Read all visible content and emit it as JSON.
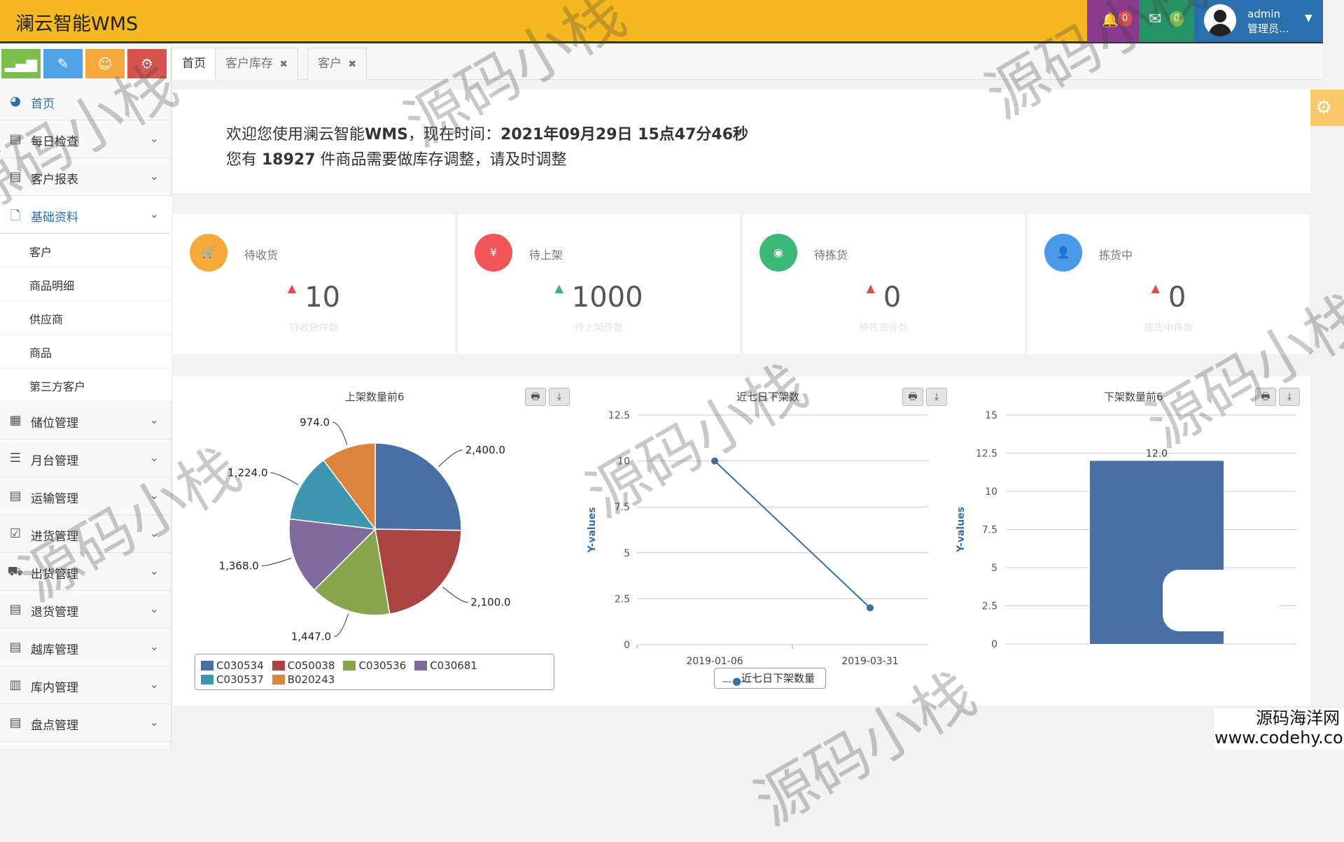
{
  "header": {
    "brand": "澜云智能WMS",
    "bell_count": "0",
    "mail_count": "0",
    "user_name": "admin",
    "user_role": "管理员...",
    "bell_color": "#8b3a8f",
    "mail_color": "#279266",
    "user_color": "#2a6fae",
    "bar_color": "#f5b820"
  },
  "sidebar": {
    "top_buttons": [
      {
        "icon": "signal-icon",
        "color": "#7cbf4f"
      },
      {
        "icon": "pencil-icon",
        "color": "#4fa3e4"
      },
      {
        "icon": "users-icon",
        "color": "#f5a93a"
      },
      {
        "icon": "cogs-icon",
        "color": "#d9534f"
      }
    ],
    "items": [
      {
        "label": "首页",
        "icon": "dashboard-icon"
      },
      {
        "label": "每日检查",
        "icon": "list-icon"
      },
      {
        "label": "客户报表",
        "icon": "list-icon"
      },
      {
        "label": "基础资料",
        "icon": "file-icon"
      },
      {
        "label": "储位管理",
        "icon": "building-icon"
      },
      {
        "label": "月台管理",
        "icon": "list-icon"
      },
      {
        "label": "运输管理",
        "icon": "list-icon"
      },
      {
        "label": "进货管理",
        "icon": "check-icon"
      },
      {
        "label": "出货管理",
        "icon": "truck-icon"
      },
      {
        "label": "退货管理",
        "icon": "list-icon"
      },
      {
        "label": "越库管理",
        "icon": "list-icon"
      },
      {
        "label": "库内管理",
        "icon": "film-icon"
      },
      {
        "label": "盘点管理",
        "icon": "list-icon"
      }
    ],
    "sub_items": [
      "客户",
      "商品明细",
      "供应商",
      "商品",
      "第三方客户"
    ]
  },
  "tabs": [
    {
      "label": "首页",
      "closable": false
    },
    {
      "label": "客户库存",
      "closable": true
    },
    {
      "label": "客户",
      "closable": true
    }
  ],
  "welcome": {
    "line1_prefix": "欢迎您使用澜云智能",
    "line1_app": "WMS",
    "line1_mid": "，现在时间：",
    "line1_time": "2021年09月29日 15点47分46秒",
    "line2_prefix": "您有 ",
    "line2_count": "18927",
    "line2_suffix": " 件商品需要做库存调整，请及时调整"
  },
  "stats": [
    {
      "label": "待收货",
      "value": "10",
      "sub": "待收货件数",
      "color": "#f5a93a",
      "icon": "cart-icon",
      "trend": "up",
      "arrow_color": "#e04b4b"
    },
    {
      "label": "待上架",
      "value": "1000",
      "sub": "待上架件数",
      "color": "#f0555a",
      "icon": "yen-icon",
      "trend": "up",
      "arrow_color": "#3cb371"
    },
    {
      "label": "待拣货",
      "value": "0",
      "sub": "待拣货件数",
      "color": "#3cb878",
      "icon": "eye-icon",
      "trend": "up",
      "arrow_color": "#e04b4b"
    },
    {
      "label": "拣货中",
      "value": "0",
      "sub": "拣货中件数",
      "color": "#4a9ae8",
      "icon": "user-icon",
      "trend": "up",
      "arrow_color": "#e04b4b"
    }
  ],
  "chart_data": [
    {
      "type": "pie",
      "title": "上架数量前6",
      "slices": [
        {
          "name": "C030534",
          "value": 2400.0,
          "label": "2,400.0",
          "color": "#4a6fa5"
        },
        {
          "name": "C050038",
          "value": 2100.0,
          "label": "2,100.0",
          "color": "#a94442"
        },
        {
          "name": "C030536",
          "value": 1447.0,
          "label": "1,447.0",
          "color": "#89a54e"
        },
        {
          "name": "C030681",
          "value": 1368.0,
          "label": "1,368.0",
          "color": "#80699b"
        },
        {
          "name": "C030537",
          "value": 1224.0,
          "label": "1,224.0",
          "color": "#3d96ae"
        },
        {
          "name": "B020243",
          "value": 974.0,
          "label": "974.0",
          "color": "#db843d"
        }
      ],
      "legend": "bottom"
    },
    {
      "type": "line",
      "title": "近七日下架数",
      "x": [
        "2019-01-06",
        "2019-03-31"
      ],
      "series": [
        {
          "name": "近七日下架数量",
          "values": [
            10,
            2
          ],
          "color": "#3a6ea5"
        }
      ],
      "ylabel": "Y-values",
      "ylim": [
        0,
        12.5
      ],
      "yticks": [
        "0",
        "2.5",
        "5",
        "7.5",
        "10",
        "12.5"
      ],
      "grid": true,
      "legend": "bottom"
    },
    {
      "type": "bar",
      "title": "下架数量前6",
      "categories": [
        ""
      ],
      "values": [
        12.0
      ],
      "value_label": "12.0",
      "color": "#4a6fa5",
      "ylabel": "Y-values",
      "ylim": [
        0,
        15
      ],
      "yticks": [
        "0",
        "2.5",
        "5",
        "7.5",
        "10",
        "12.5",
        "15"
      ],
      "grid": true
    }
  ],
  "watermark": "源码小栈",
  "corner": {
    "line1": "源码海洋网",
    "line2": "www.codehy.com"
  }
}
